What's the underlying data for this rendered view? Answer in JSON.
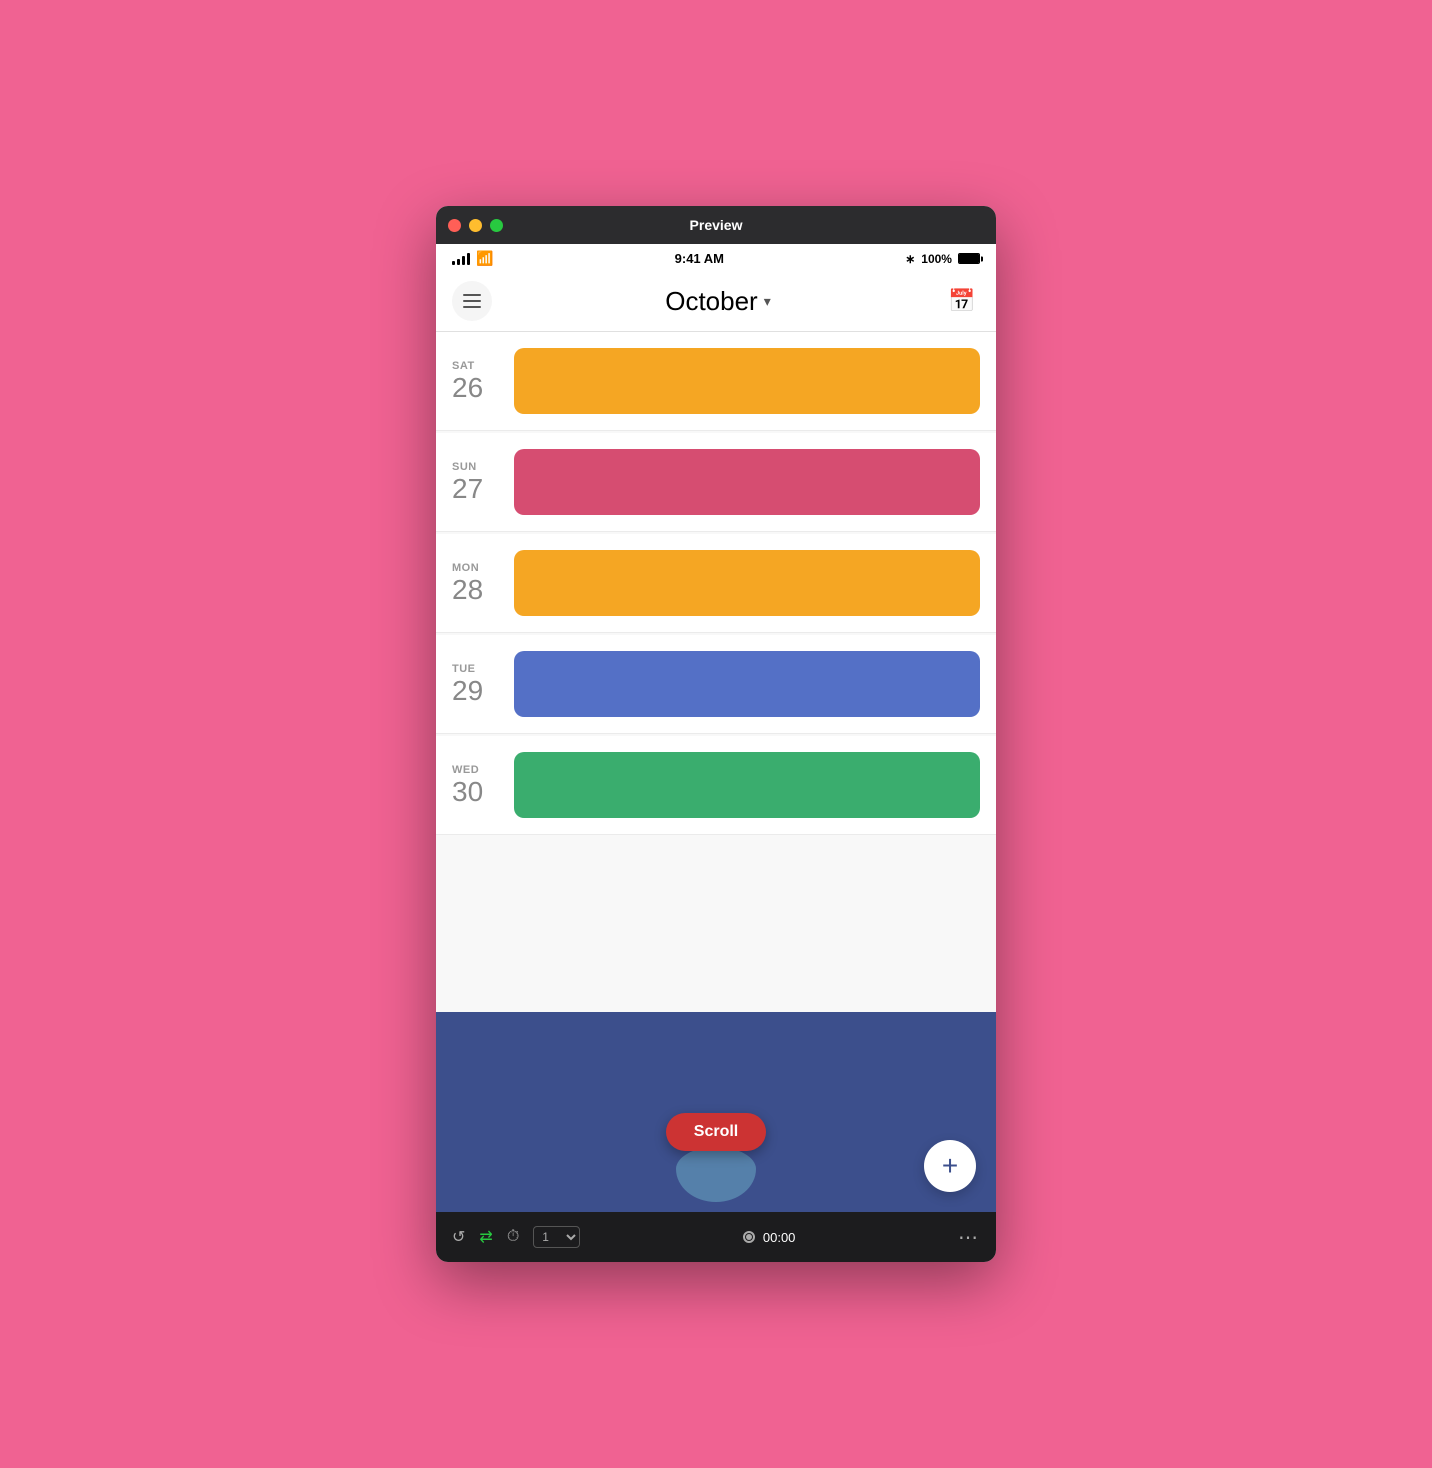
{
  "window": {
    "title": "Preview"
  },
  "status_bar": {
    "time": "9:41 AM",
    "battery_percent": "100%",
    "bluetooth": "bluetooth"
  },
  "header": {
    "month": "October",
    "menu_label": "menu",
    "calendar_icon": "calendar"
  },
  "days": [
    {
      "day_name": "SAT",
      "day_number": "26",
      "event_color": "color-orange"
    },
    {
      "day_name": "SUN",
      "day_number": "27",
      "event_color": "color-pink"
    },
    {
      "day_name": "MON",
      "day_number": "28",
      "event_color": "color-orange"
    },
    {
      "day_name": "TUE",
      "day_number": "29",
      "event_color": "color-blue"
    },
    {
      "day_name": "WED",
      "day_number": "30",
      "event_color": "color-green"
    }
  ],
  "scroll_button": {
    "label": "Scroll"
  },
  "fab": {
    "label": "+"
  },
  "toolbar": {
    "timecode": "00:00",
    "speed": "1"
  }
}
